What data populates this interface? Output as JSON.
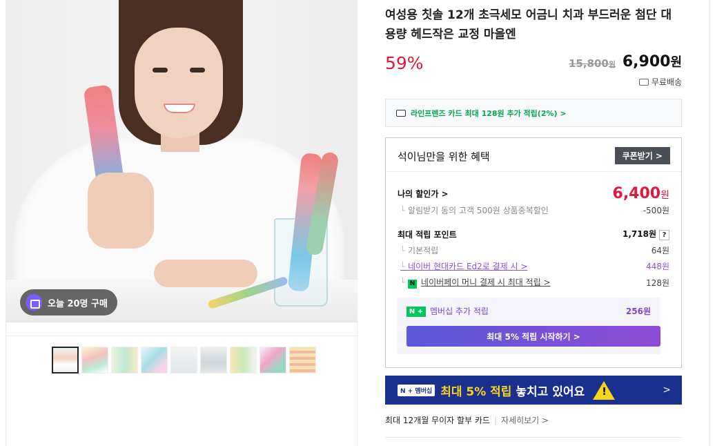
{
  "product": {
    "title": "여성용 칫솔 12개 초극세모 어금니 치과 부드러운 첨단 대용량 헤드작은 교정 마을엔",
    "discount_rate": "59%",
    "original_price": "15,800",
    "original_unit": "원",
    "sale_price": "6,900",
    "sale_unit": "원",
    "shipping": "무료배송"
  },
  "gallery": {
    "purchase_badge": "오늘 20명 구매",
    "thumbnail_count": 9
  },
  "card_promo": "라인프렌즈 카드 최대 128원 추가 적립(2%) >",
  "benefit": {
    "heading": "석이님만을 위한 혜택",
    "coupon_button": "쿠폰받기 >",
    "my_discount_label": "나의 할인가 >",
    "my_discount_price": "6,400",
    "my_discount_unit": "원",
    "alert_discount_label": "알림받기 동의 고객 500원 상품중복할인",
    "alert_discount_value": "-500원",
    "max_points_label": "최대 적립 포인트",
    "max_points_value": "1,718원",
    "help": "?",
    "basic_label": "기본적립",
    "basic_value": "64원",
    "hyundai_label": "네이버 현대카드 Ed2로 결제 시 >",
    "hyundai_value": "448원",
    "npay_icon": "N",
    "npay_label": "네이버페이 머니 결제 시 최대 적립 >",
    "npay_value": "128원",
    "membership_badge": "N +",
    "membership_label": "멤버십 추가 적립",
    "membership_value": "256원",
    "membership_button": "최대 5% 적립 시작하기 >"
  },
  "banner": {
    "badge": "N + 멤버십",
    "text_highlight": "최대 5% 적립",
    "text_rest": " 놓치고 있어요",
    "warn_mark": "!",
    "chevron": ">"
  },
  "installment": {
    "label": "최대 12개월 무이자 할부 카드",
    "more": "자세히보기 >"
  },
  "colors": {
    "discount_red": "#e3193b",
    "naver_green": "#03c75a",
    "membership_purple": "#7b47d6",
    "banner_navy": "#1b2f8f"
  }
}
